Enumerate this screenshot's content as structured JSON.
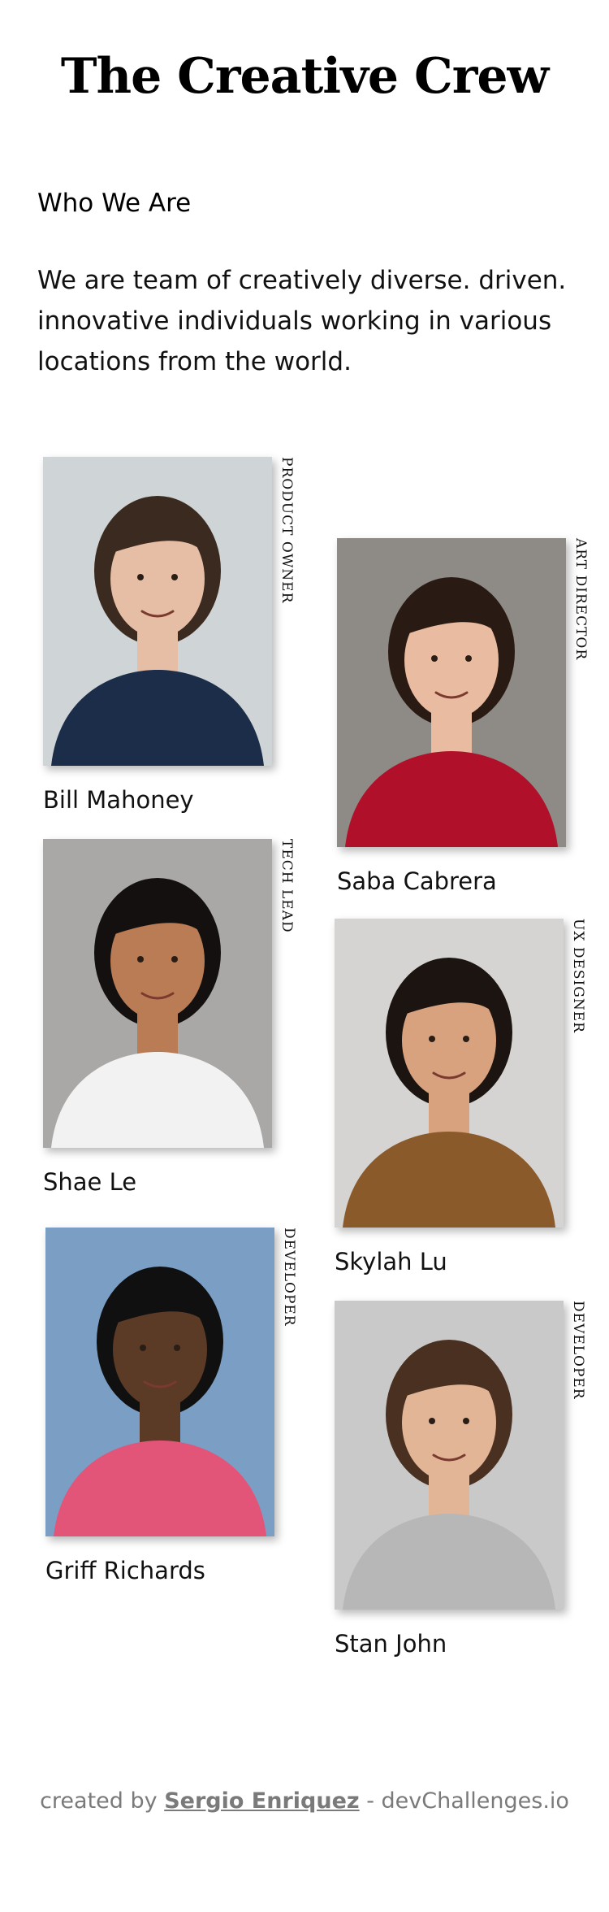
{
  "page": {
    "title": "The Creative Crew",
    "section_heading": "Who We Are",
    "intro": "We are team of creatively diverse. driven. innovative individuals working in various locations from the world."
  },
  "members": [
    {
      "name": "Bill Mahoney",
      "role": "PRODUCT OWNER",
      "bg": "#cfd4d6",
      "skin": "#e6bea5",
      "hair": "#3b2a1f",
      "shirt": "#1c2d4a"
    },
    {
      "name": "Saba Cabrera",
      "role": "ART DIRECTOR",
      "bg": "#8e8a86",
      "skin": "#e9bba0",
      "hair": "#2a1a14",
      "shirt": "#b0102a"
    },
    {
      "name": "Shae Le",
      "role": "TECH LEAD",
      "bg": "#a9a8a6",
      "skin": "#b97c55",
      "hair": "#141010",
      "shirt": "#f2f2f2"
    },
    {
      "name": "Skylah Lu",
      "role": "UX DESIGNER",
      "bg": "#d6d4d2",
      "skin": "#d8a27e",
      "hair": "#1c1410",
      "shirt": "#8b5a2b"
    },
    {
      "name": "Griff Richards",
      "role": "DEVELOPER",
      "bg": "#7a9ec4",
      "skin": "#5b3a26",
      "hair": "#101010",
      "shirt": "#e25578"
    },
    {
      "name": "Stan John",
      "role": "DEVELOPER",
      "bg": "#c9c9c9",
      "skin": "#e2b597",
      "hair": "#4a3020",
      "shirt": "#b7b7b7"
    }
  ],
  "footer": {
    "prefix": "created by ",
    "author": "Sergio Enriquez",
    "suffix": " - devChallenges.io"
  }
}
